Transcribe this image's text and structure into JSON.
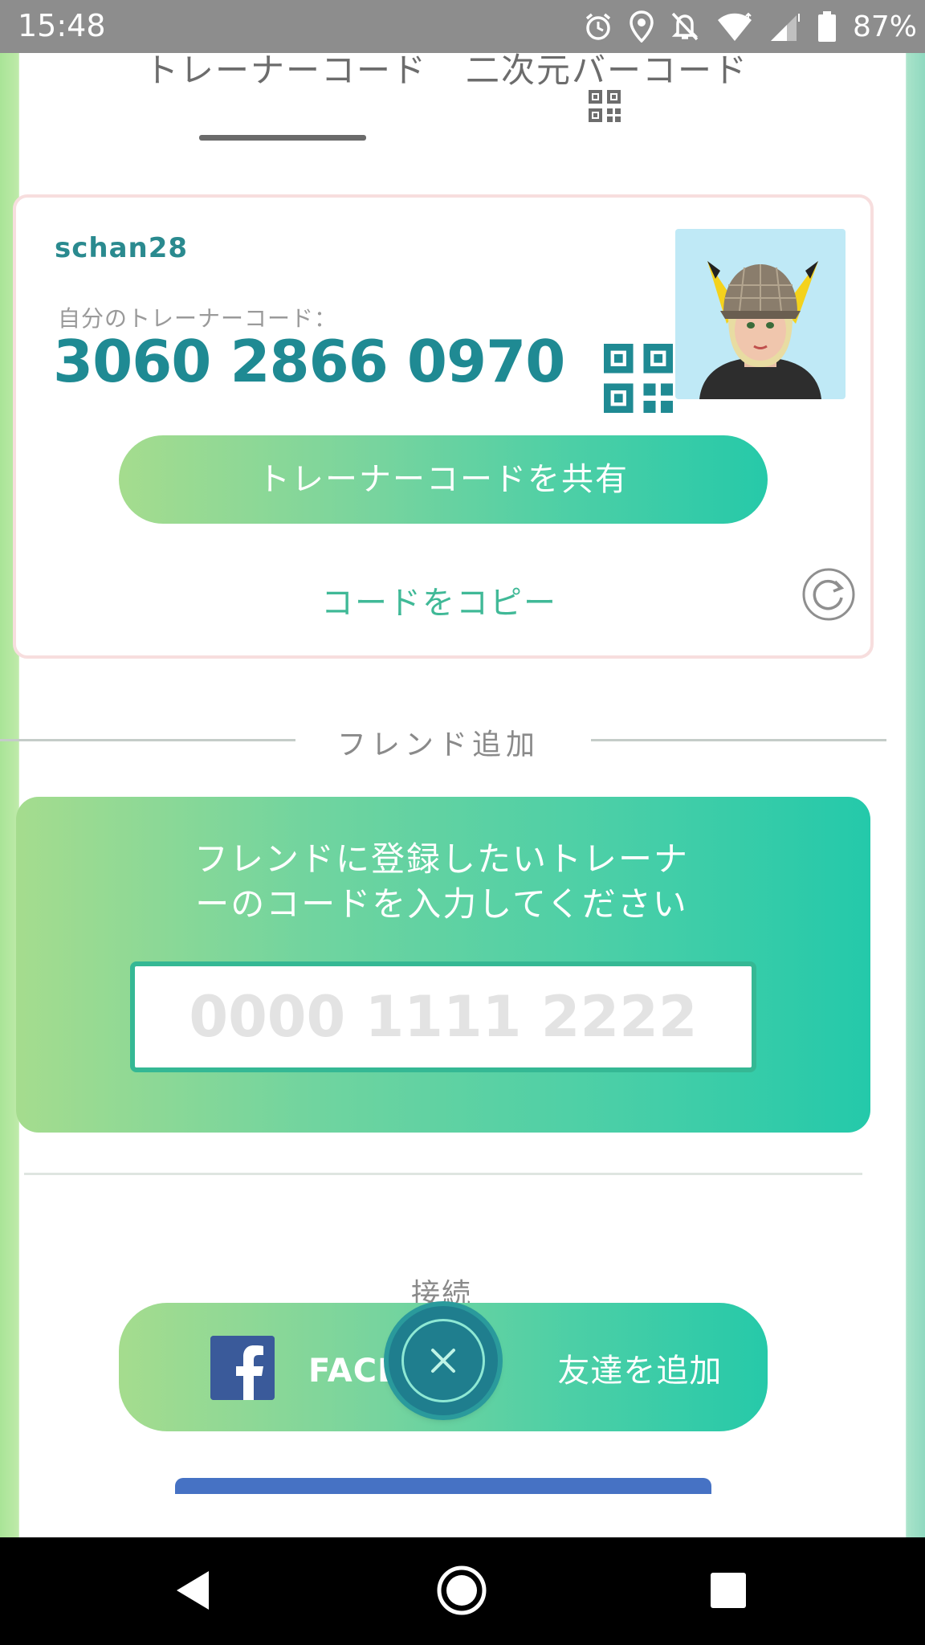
{
  "status_bar": {
    "time": "15:48",
    "battery_percent": "87%",
    "icons": [
      "alarm-icon",
      "location-icon",
      "bell-off-icon",
      "wifi-icon",
      "signal-icon",
      "battery-icon"
    ]
  },
  "tabs": [
    {
      "label": "トレーナーコード",
      "active": true
    },
    {
      "label": "二次元バーコード",
      "active": false
    }
  ],
  "trainer_card": {
    "username": "schan28",
    "code_label": "自分のトレーナーコード：",
    "code": "3060 2866 0970",
    "share_button": "トレーナーコードを共有",
    "copy_link": "コードをコピー"
  },
  "friend_add": {
    "section_title": "フレンド追加",
    "prompt_line1": "フレンドに登録したいトレーナ",
    "prompt_line2": "ーのコードを入力してください",
    "input_placeholder": "0000 1111 2222",
    "input_value": ""
  },
  "connect": {
    "section_title": "接続",
    "facebook_button_prefix": "FACE",
    "facebook_button_suffix": "友達を追加"
  },
  "colors": {
    "accent_teal": "#1f8a93",
    "gradient_start": "#a5dc8e",
    "gradient_end": "#24c9aa",
    "facebook_blue": "#3a5a9a"
  }
}
